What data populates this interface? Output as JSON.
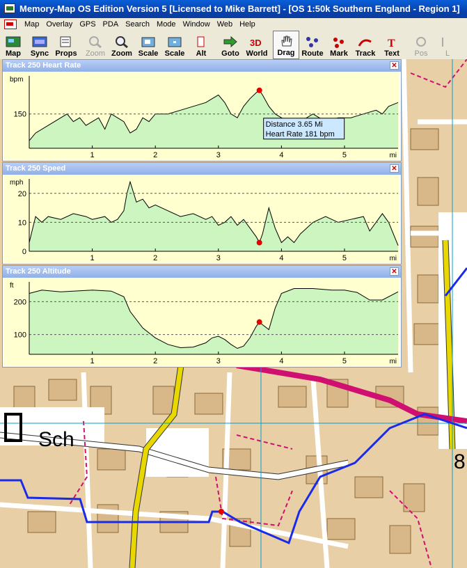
{
  "window": {
    "title": "Memory-Map OS Edition Version 5 [Licensed to Mike Barrett] - [OS 1:50k Southern England - Region 1]"
  },
  "menu": [
    "Map",
    "Overlay",
    "GPS",
    "PDA",
    "Search",
    "Mode",
    "Window",
    "Web",
    "Help"
  ],
  "toolbar": [
    {
      "label": "Map",
      "icon": "map-icon",
      "enabled": true
    },
    {
      "label": "Sync",
      "icon": "sync-icon",
      "enabled": true
    },
    {
      "label": "Props",
      "icon": "props-icon",
      "enabled": true
    },
    {
      "label": "Zoom",
      "icon": "zoom-in-icon",
      "enabled": false
    },
    {
      "label": "Zoom",
      "icon": "zoom-out-icon",
      "enabled": true
    },
    {
      "label": "Scale",
      "icon": "scale-up-icon",
      "enabled": true
    },
    {
      "label": "Scale",
      "icon": "scale-down-icon",
      "enabled": true
    },
    {
      "label": "Alt",
      "icon": "alt-icon",
      "enabled": true
    },
    {
      "label": "Goto",
      "icon": "goto-icon",
      "enabled": true
    },
    {
      "label": "World",
      "icon": "3d-world-icon",
      "enabled": true
    },
    {
      "label": "Drag",
      "icon": "hand-icon",
      "enabled": true,
      "active": true
    },
    {
      "label": "Route",
      "icon": "route-icon",
      "enabled": true
    },
    {
      "label": "Mark",
      "icon": "mark-icon",
      "enabled": true
    },
    {
      "label": "Track",
      "icon": "track-icon",
      "enabled": true
    },
    {
      "label": "Text",
      "icon": "text-icon",
      "enabled": true
    },
    {
      "label": "Pos",
      "icon": "pos-icon",
      "enabled": false
    },
    {
      "label": "L",
      "icon": "log-icon",
      "enabled": false
    }
  ],
  "map": {
    "label": "Sch",
    "label2": "8"
  },
  "colors": {
    "route": "#1a2be8",
    "road_major": "#e8d800",
    "road_minor": "#ffffff",
    "railway": "#d01070",
    "map_bg": "#e8cfa6",
    "fill": "#ccf5c0",
    "plot_bg": "#ffffd0"
  },
  "panels": [
    {
      "title": "Track 250 Heart Rate",
      "unit": "bpm",
      "yticks": [
        "150"
      ],
      "xticks": [
        "1",
        "2",
        "3",
        "4",
        "5"
      ],
      "xunit": "mi",
      "tooltip": {
        "line1": "Distance 3.65 Mi",
        "line2": "Heart Rate 181 bpm"
      }
    },
    {
      "title": "Track 250 Speed",
      "unit": "mph",
      "yticks": [
        "20",
        "10",
        "0"
      ],
      "xticks": [
        "1",
        "2",
        "3",
        "4",
        "5"
      ],
      "xunit": "mi"
    },
    {
      "title": "Track 250 Altitude",
      "unit": "ft",
      "yticks": [
        "200",
        "100"
      ],
      "xticks": [
        "1",
        "2",
        "3",
        "4",
        "5"
      ],
      "xunit": "mi"
    }
  ],
  "chart_data": [
    {
      "type": "area",
      "title": "Track 250 Heart Rate",
      "ylabel": "bpm",
      "xlabel": "mi",
      "xlim": [
        0,
        5.85
      ],
      "ylim": [
        105,
        200
      ],
      "yticks": [
        150
      ],
      "grid": true,
      "x": [
        0,
        0.1,
        0.3,
        0.5,
        0.6,
        0.7,
        0.8,
        0.9,
        1.0,
        1.1,
        1.2,
        1.3,
        1.4,
        1.5,
        1.6,
        1.7,
        1.8,
        1.9,
        2.0,
        2.2,
        2.4,
        2.6,
        2.8,
        2.9,
        3.0,
        3.1,
        3.2,
        3.3,
        3.4,
        3.5,
        3.6,
        3.65,
        3.7,
        3.8,
        3.9,
        4.0,
        4.1,
        4.2,
        4.3,
        4.5,
        4.7,
        4.9,
        5.1,
        5.3,
        5.5,
        5.6,
        5.7,
        5.85
      ],
      "y": [
        115,
        125,
        135,
        145,
        150,
        140,
        145,
        135,
        140,
        145,
        130,
        150,
        145,
        140,
        125,
        130,
        145,
        140,
        150,
        150,
        155,
        160,
        165,
        170,
        175,
        165,
        150,
        145,
        160,
        170,
        178,
        181,
        175,
        160,
        150,
        145,
        140,
        130,
        140,
        150,
        140,
        145,
        145,
        150,
        155,
        150,
        160,
        165
      ],
      "marker": {
        "x": 3.65,
        "y": 181
      }
    },
    {
      "type": "area",
      "title": "Track 250 Speed",
      "ylabel": "mph",
      "xlabel": "mi",
      "xlim": [
        0,
        5.85
      ],
      "ylim": [
        0,
        25
      ],
      "yticks": [
        20,
        10,
        0
      ],
      "grid": true,
      "x": [
        0,
        0.1,
        0.2,
        0.3,
        0.5,
        0.7,
        0.9,
        1.0,
        1.2,
        1.3,
        1.4,
        1.5,
        1.55,
        1.6,
        1.7,
        1.8,
        1.9,
        2.0,
        2.2,
        2.4,
        2.6,
        2.8,
        2.9,
        3.0,
        3.1,
        3.2,
        3.3,
        3.4,
        3.5,
        3.6,
        3.65,
        3.7,
        3.8,
        3.9,
        4.0,
        4.1,
        4.2,
        4.3,
        4.5,
        4.7,
        4.9,
        5.1,
        5.3,
        5.4,
        5.5,
        5.6,
        5.7,
        5.85
      ],
      "y": [
        3,
        12,
        10,
        12,
        11,
        13,
        12,
        11,
        12,
        10,
        11,
        14,
        20,
        24,
        17,
        18,
        15,
        16,
        14,
        12,
        13,
        11,
        12,
        9,
        10,
        12,
        9,
        11,
        8,
        5,
        3,
        6,
        15,
        8,
        3,
        5,
        3,
        6,
        10,
        12,
        10,
        11,
        12,
        7,
        10,
        13,
        10,
        2
      ],
      "marker": {
        "x": 3.65,
        "y": 3
      }
    },
    {
      "type": "area",
      "title": "Track 250 Altitude",
      "ylabel": "ft",
      "xlabel": "mi",
      "xlim": [
        0,
        5.85
      ],
      "ylim": [
        40,
        260
      ],
      "yticks": [
        200,
        100
      ],
      "grid": true,
      "x": [
        0,
        0.2,
        0.5,
        1.0,
        1.3,
        1.5,
        1.6,
        1.8,
        2.0,
        2.2,
        2.4,
        2.6,
        2.8,
        2.9,
        3.0,
        3.1,
        3.2,
        3.3,
        3.4,
        3.5,
        3.6,
        3.65,
        3.7,
        3.8,
        3.9,
        4.0,
        4.2,
        4.5,
        4.8,
        5.0,
        5.2,
        5.4,
        5.6,
        5.85
      ],
      "y": [
        225,
        235,
        230,
        235,
        232,
        215,
        170,
        120,
        90,
        70,
        60,
        62,
        75,
        90,
        95,
        85,
        70,
        58,
        65,
        90,
        125,
        138,
        130,
        115,
        180,
        225,
        240,
        240,
        235,
        235,
        228,
        205,
        205,
        230
      ],
      "marker": {
        "x": 3.65,
        "y": 138
      }
    }
  ]
}
